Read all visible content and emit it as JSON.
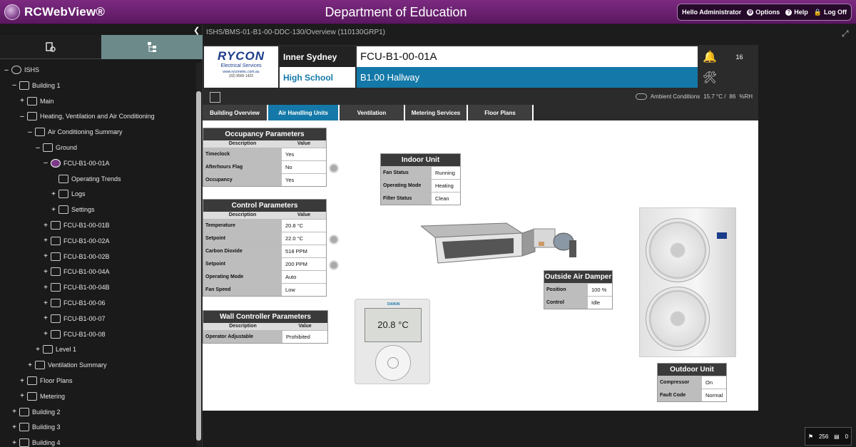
{
  "app": {
    "logo_text": "RCWebView®",
    "title": "Department of Education"
  },
  "user": {
    "greeting": "Hello Administrator",
    "options": "Options",
    "help": "Help",
    "logoff": "Log Off"
  },
  "breadcrumb": "ISHS/BMS-01-B1-00-DDC-130/Overview (110130GRP1)",
  "tree": [
    {
      "label": "ISHS",
      "toggle": "–",
      "depth": 0
    },
    {
      "label": "Building 1",
      "toggle": "–",
      "depth": 1
    },
    {
      "label": "Main",
      "toggle": "+",
      "depth": 2
    },
    {
      "label": "Heating, Ventilation and Air Conditioning",
      "toggle": "–",
      "depth": 2
    },
    {
      "label": "Air Conditioning Summary",
      "toggle": "–",
      "depth": 3
    },
    {
      "label": "Ground",
      "toggle": "–",
      "depth": 4
    },
    {
      "label": "FCU-B1-00-01A",
      "toggle": "–",
      "depth": 5
    },
    {
      "label": "Operating Trends",
      "toggle": "",
      "depth": 6
    },
    {
      "label": "Logs",
      "toggle": "+",
      "depth": 6
    },
    {
      "label": "Settings",
      "toggle": "+",
      "depth": 6
    },
    {
      "label": "FCU-B1-00-01B",
      "toggle": "+",
      "depth": 5
    },
    {
      "label": "FCU-B1-00-02A",
      "toggle": "+",
      "depth": 5
    },
    {
      "label": "FCU-B1-00-02B",
      "toggle": "+",
      "depth": 5
    },
    {
      "label": "FCU-B1-00-04A",
      "toggle": "+",
      "depth": 5
    },
    {
      "label": "FCU-B1-00-04B",
      "toggle": "+",
      "depth": 5
    },
    {
      "label": "FCU-B1-00-06",
      "toggle": "+",
      "depth": 5
    },
    {
      "label": "FCU-B1-00-07",
      "toggle": "+",
      "depth": 5
    },
    {
      "label": "FCU-B1-00-08",
      "toggle": "+",
      "depth": 5
    },
    {
      "label": "Level 1",
      "toggle": "+",
      "depth": 4
    },
    {
      "label": "Ventilation Summary",
      "toggle": "+",
      "depth": 3
    },
    {
      "label": "Floor Plans",
      "toggle": "+",
      "depth": 2
    },
    {
      "label": "Metering",
      "toggle": "+",
      "depth": 2
    },
    {
      "label": "Building 2",
      "toggle": "+",
      "depth": 1
    },
    {
      "label": "Building 3",
      "toggle": "+",
      "depth": 1
    },
    {
      "label": "Building 4",
      "toggle": "+",
      "depth": 1
    }
  ],
  "header": {
    "company": "RYCON",
    "company_sub": "Electrical Services",
    "company_web": "www.ryconelec.com.au",
    "company_phone": "(02) 9565 1423",
    "site_line1": "Inner Sydney",
    "site_line2": "High School",
    "device": "FCU-B1-00-01A",
    "location": "B1.00 Hallway",
    "alarm_count": "16"
  },
  "ambient": {
    "label": "Ambient Conditions",
    "temp": "15.7 °C /",
    "humidity": "86",
    "humidity_unit": "%RH"
  },
  "tabs": [
    {
      "label": "Building Overview",
      "active": false
    },
    {
      "label": "Air Handling Units",
      "active": true
    },
    {
      "label": "Ventilation",
      "active": false
    },
    {
      "label": "Metering Services",
      "active": false
    },
    {
      "label": "Floor Plans",
      "active": false
    }
  ],
  "col_headers": {
    "description": "Description",
    "value": "Value"
  },
  "occupancy": {
    "title": "Occupancy Parameters",
    "rows": [
      {
        "k": "Timeclock",
        "v": "Yes"
      },
      {
        "k": "Afterhours Flag",
        "v": "No"
      },
      {
        "k": "Occupancy",
        "v": "Yes"
      }
    ]
  },
  "control": {
    "title": "Control Parameters",
    "rows": [
      {
        "k": "Temperature",
        "v": "20.8 °C"
      },
      {
        "k": "Setpoint",
        "v": "22.0 °C"
      },
      {
        "k": "Carbon Dioxide",
        "v": "518 PPM"
      },
      {
        "k": "Setpoint",
        "v": "200 PPM"
      },
      {
        "k": "Operating Mode",
        "v": "Auto"
      },
      {
        "k": "Fan Speed",
        "v": "Low"
      }
    ]
  },
  "wall": {
    "title": "Wall Controller Parameters",
    "rows": [
      {
        "k": "Operator Adjustable",
        "v": "Prohibited"
      }
    ]
  },
  "indoor": {
    "title": "Indoor Unit",
    "rows": [
      {
        "k": "Fan Status",
        "v": "Running"
      },
      {
        "k": "Operating Mode",
        "v": "Heating"
      },
      {
        "k": "Filter Status",
        "v": "Clean"
      }
    ]
  },
  "damper": {
    "title": "Outside Air Damper",
    "rows": [
      {
        "k": "Position",
        "v": "100 %"
      },
      {
        "k": "Control",
        "v": "Idle"
      }
    ]
  },
  "outdoor": {
    "title": "Outdoor Unit",
    "rows": [
      {
        "k": "Compressor",
        "v": "On"
      },
      {
        "k": "Fault Code",
        "v": "Normal"
      }
    ]
  },
  "thermostat": {
    "brand": "DAIKIN",
    "display": "20.8 °C"
  },
  "footer": {
    "alarms": "256",
    "events": "0"
  },
  "colors": {
    "accent": "#1479a8",
    "brand": "#6a2270"
  }
}
